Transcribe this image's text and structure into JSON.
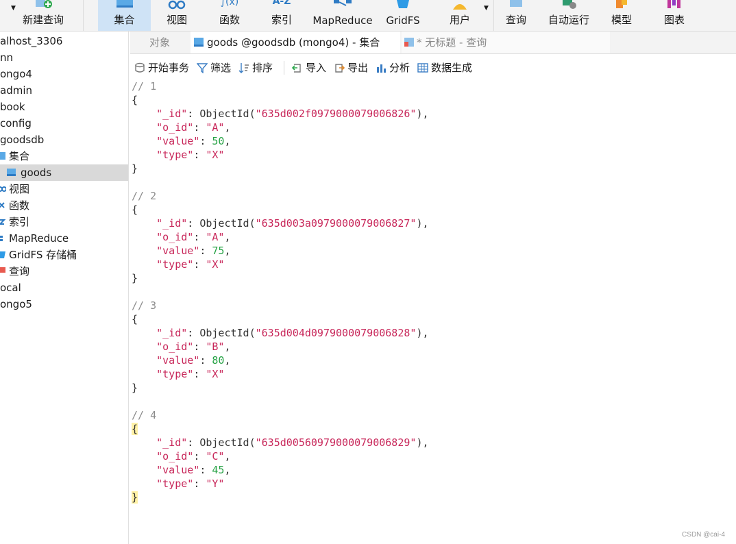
{
  "toolbar": {
    "new_query": "新建查询",
    "collections": "集合",
    "views": "视图",
    "functions": "函数",
    "indexes": "索引",
    "mapreduce": "MapReduce",
    "gridfs": "GridFS",
    "users": "用户",
    "query": "查询",
    "automation": "自动运行",
    "model": "模型",
    "charts": "图表",
    "functions_glyph": "∫(x)",
    "indexes_glyph": "A-Z"
  },
  "sidebar": {
    "items": [
      {
        "label": "alhost_3306"
      },
      {
        "label": "nn"
      },
      {
        "label": "ongo4"
      },
      {
        "label": "admin"
      },
      {
        "label": "book"
      },
      {
        "label": "config"
      },
      {
        "label": "goodsdb"
      },
      {
        "label": "集合"
      },
      {
        "label": "goods"
      },
      {
        "label": "视图"
      },
      {
        "label": "函数"
      },
      {
        "label": "索引"
      },
      {
        "label": "MapReduce"
      },
      {
        "label": "GridFS 存储桶"
      },
      {
        "label": "查询"
      },
      {
        "label": "ocal"
      },
      {
        "label": "ongo5"
      }
    ]
  },
  "tabs": {
    "objects": "对象",
    "goods": "goods @goodsdb (mongo4) - 集合",
    "untitled": "* 无标题 - 查询"
  },
  "subtoolbar": {
    "begin_transaction": "开始事务",
    "filter": "筛选",
    "sort": "排序",
    "import": "导入",
    "export": "导出",
    "analyze": "分析",
    "data_generation": "数据生成"
  },
  "documents": [
    {
      "index": "// 1",
      "_id": "\"635d002f0979000079006826\"",
      "o_id": "\"A\"",
      "value": "50",
      "type": "\"X\""
    },
    {
      "index": "// 2",
      "_id": "\"635d003a0979000079006827\"",
      "o_id": "\"A\"",
      "value": "75",
      "type": "\"X\""
    },
    {
      "index": "// 3",
      "_id": "\"635d004d0979000079006828\"",
      "o_id": "\"B\"",
      "value": "80",
      "type": "\"X\""
    },
    {
      "index": "// 4",
      "_id": "\"635d00560979000079006829\"",
      "o_id": "\"C\"",
      "value": "45",
      "type": "\"Y\""
    }
  ],
  "syntax": {
    "open_brace": "{",
    "close_brace": "}",
    "key_id": "\"_id\"",
    "key_o_id": "\"o_id\"",
    "key_value": "\"value\"",
    "key_type": "\"type\"",
    "colon": ": ",
    "comma": ",",
    "objectid_open": "ObjectId(",
    "objectid_close": "),"
  },
  "watermark": "CSDN @cai-4",
  "colors": {
    "accent": "#cfe3f6",
    "key": "#c8275a",
    "number": "#25a244",
    "comment": "#8c8c8c"
  }
}
